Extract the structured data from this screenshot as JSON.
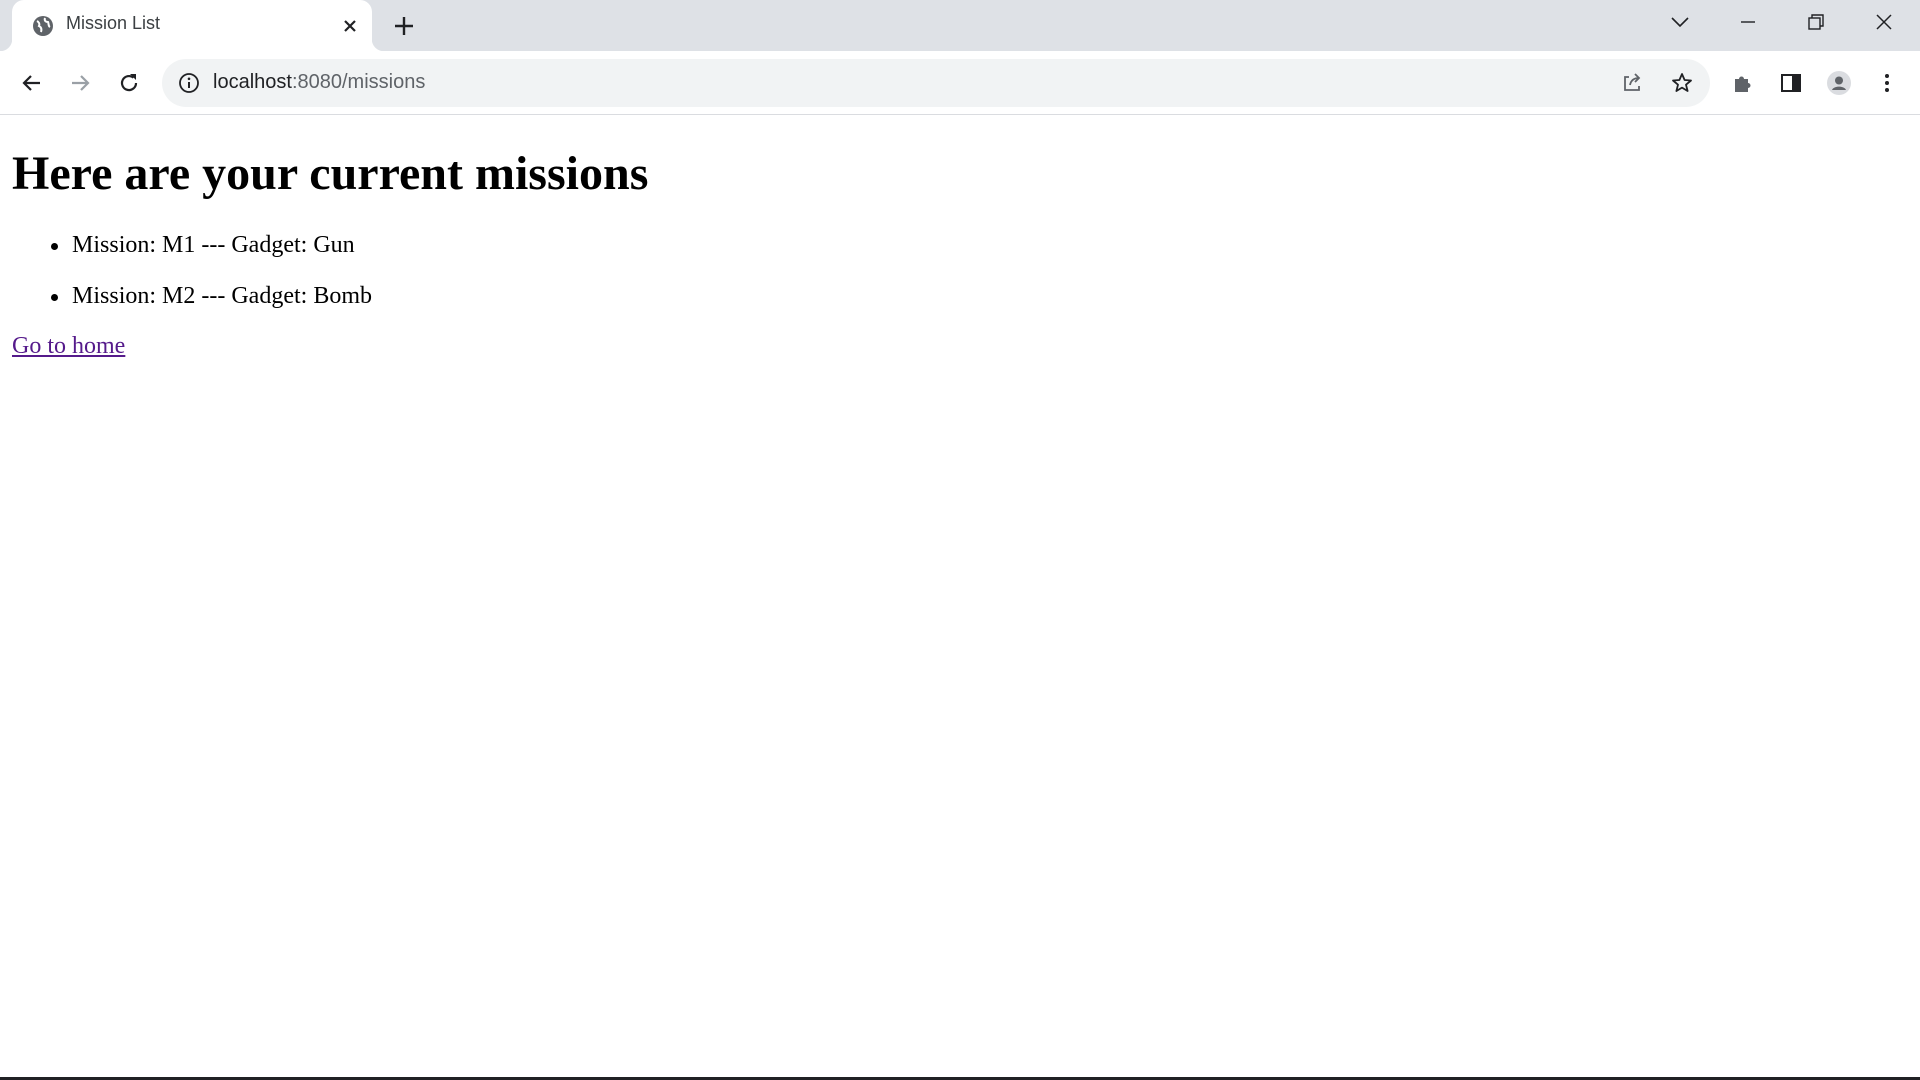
{
  "browser": {
    "tab": {
      "title": "Mission List",
      "favicon": "globe-icon"
    },
    "address": {
      "host": "localhost",
      "path": ":8080/missions"
    },
    "colors": {
      "tabstrip": "#dee1e6",
      "omnibox": "#f1f3f4",
      "visited_link": "#551a8b"
    }
  },
  "page": {
    "heading": "Here are your current missions",
    "missions": [
      "Mission: M1 --- Gadget: Gun",
      "Mission: M2 --- Gadget: Bomb"
    ],
    "home_link": "Go to home"
  }
}
